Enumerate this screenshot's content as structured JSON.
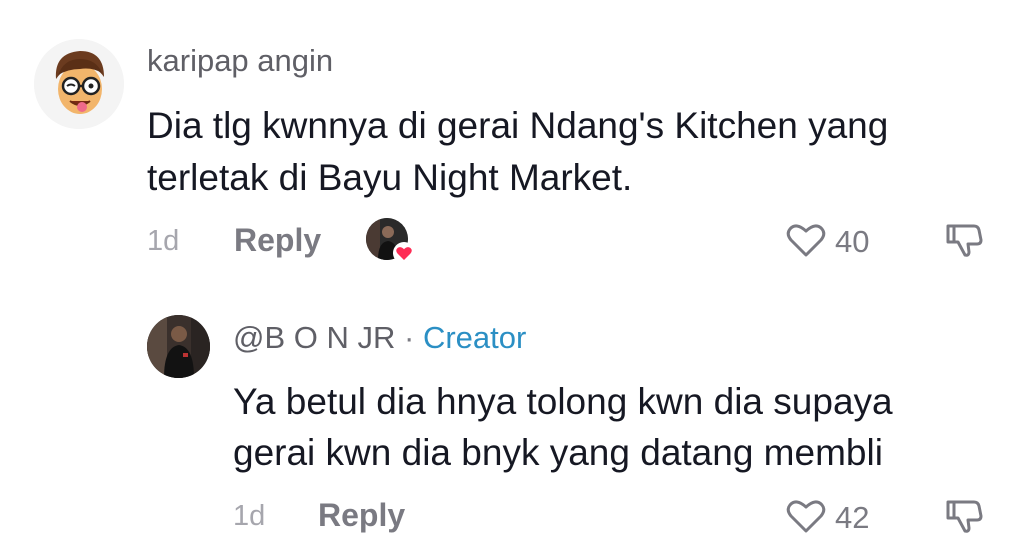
{
  "comment": {
    "username": "karipap angin",
    "text_line1": "Dia tlg kwnnya di gerai Ndang's Kitchen yang",
    "text_line2": "terletak di Bayu Night Market.",
    "time": "1d",
    "reply_label": "Reply",
    "likes": "40",
    "avatar_icon": "emoji-face-with-glasses-avatar",
    "liked_by_creator_icon": "creator-avatar-with-heart"
  },
  "reply": {
    "username": "@B O N JR",
    "separator": "·",
    "badge": "Creator",
    "text_line1": "Ya betul dia hnya tolong kwn dia supaya",
    "text_line2": "gerai kwn dia bnyk yang datang membli",
    "time": "1d",
    "reply_label": "Reply",
    "likes": "42",
    "avatar_icon": "profile-photo-avatar"
  },
  "colors": {
    "text": "#161823",
    "secondary": "#7a7a82",
    "creator_badge": "#2b8fc4",
    "heart_badge": "#fe2c55"
  }
}
